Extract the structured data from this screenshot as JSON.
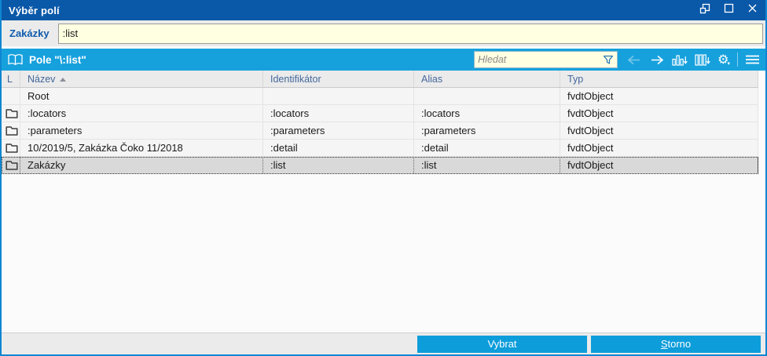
{
  "window": {
    "title": "Výběr polí"
  },
  "field": {
    "label": "Zakázky",
    "value": ":list"
  },
  "panel": {
    "title": "Pole \"\\:list\"",
    "search_placeholder": "Hledat"
  },
  "table": {
    "columns": [
      "L",
      "Název",
      "Identifikátor",
      "Alias",
      "Typ"
    ],
    "sort": {
      "column": "Název",
      "direction": "asc"
    },
    "rows": [
      {
        "name": "Root",
        "identifier": "",
        "alias": "",
        "type": "fvdtObject",
        "folder": false,
        "selected": false
      },
      {
        "name": ":locators",
        "identifier": ":locators",
        "alias": ":locators",
        "type": "fvdtObject",
        "folder": true,
        "selected": false
      },
      {
        "name": ":parameters",
        "identifier": ":parameters",
        "alias": ":parameters",
        "type": "fvdtObject",
        "folder": true,
        "selected": false
      },
      {
        "name": "10/2019/5, Zakázka Čoko 11/2018",
        "identifier": ":detail",
        "alias": ":detail",
        "type": "fvdtObject",
        "folder": true,
        "selected": false
      },
      {
        "name": "Zakázky",
        "identifier": ":list",
        "alias": ":list",
        "type": "fvdtObject",
        "folder": true,
        "selected": true
      }
    ]
  },
  "buttons": {
    "select": {
      "label": "Vybrat"
    },
    "cancel": {
      "label": "Storno",
      "accel": "S"
    }
  },
  "colors": {
    "titlebar": "#0a58a8",
    "accent": "#16a1dd",
    "button": "#0d9ddb",
    "input_bg": "#ffffe1",
    "selection_bg": "#d9d9d9"
  }
}
